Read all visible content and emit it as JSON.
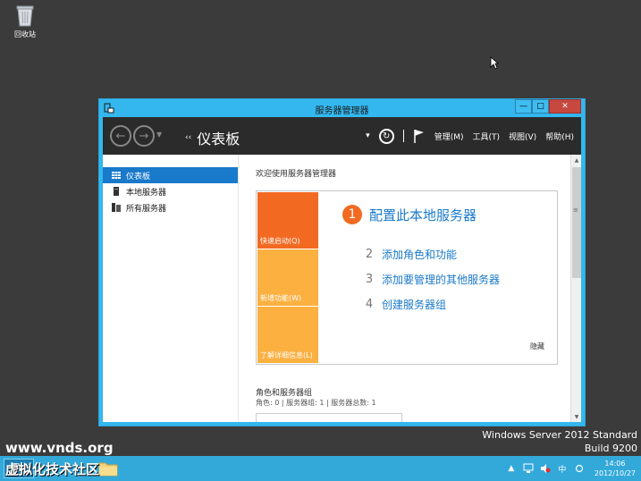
{
  "desktop": {
    "recycle_bin_label": "回收站",
    "watermark_url": "www.vnds.org",
    "watermark_cn": "虚拟化技术社区",
    "os_name": "Windows Server 2012 Standard",
    "os_build": "Build 9200"
  },
  "window": {
    "title": "服务器管理器",
    "minimize": "—",
    "maximize": "□",
    "close": "✕"
  },
  "commandbar": {
    "breadcrumb_arrows": "‹‹",
    "breadcrumb": "仪表板",
    "menus": [
      "管理(M)",
      "工具(T)",
      "视图(V)",
      "帮助(H)"
    ]
  },
  "sidebar": {
    "items": [
      {
        "label": "仪表板",
        "icon": "dashboard-icon",
        "active": true
      },
      {
        "label": "本地服务器",
        "icon": "server-icon",
        "active": false
      },
      {
        "label": "所有服务器",
        "icon": "servers-icon",
        "active": false
      }
    ]
  },
  "main": {
    "welcome": "欢迎使用服务器管理器",
    "tiles": [
      "快速启动(Q)",
      "新增功能(W)",
      "了解详细信息(L)"
    ],
    "step1": {
      "num": "1",
      "label": "配置此本地服务器"
    },
    "steps": [
      {
        "num": "2",
        "label": "添加角色和功能"
      },
      {
        "num": "3",
        "label": "添加要管理的其他服务器"
      },
      {
        "num": "4",
        "label": "创建服务器组"
      }
    ],
    "hide": "隐藏",
    "roles_title": "角色和服务器组",
    "roles_summary": "角色: 0 | 服务器组: 1 | 服务器总数: 1"
  },
  "taskbar": {
    "time": "14:06",
    "date": "2012/10/27",
    "ime": "中"
  },
  "colors": {
    "accent_blue": "#1979ca",
    "tile_orange": "#f26a22",
    "tile_amber": "#fbb040",
    "taskbar": "#33a9da"
  }
}
